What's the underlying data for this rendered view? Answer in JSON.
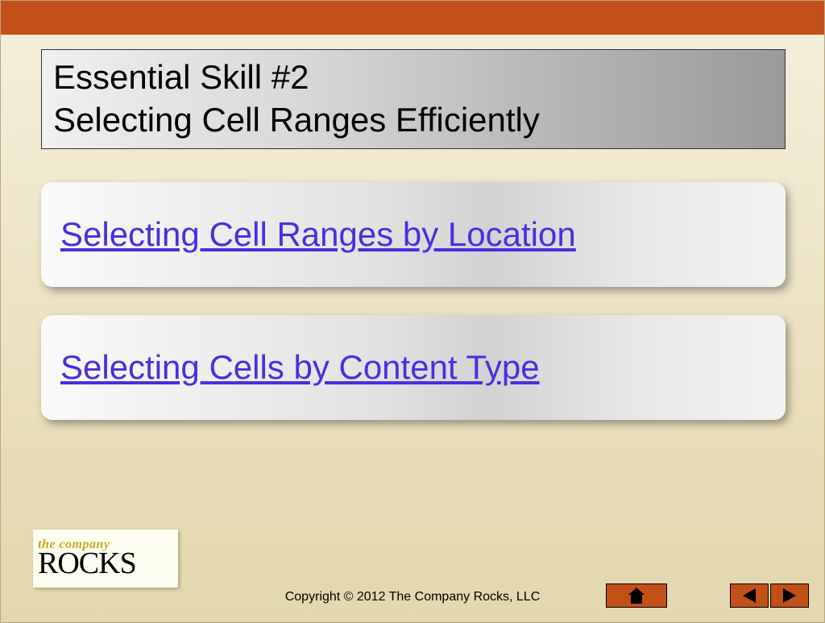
{
  "title": {
    "line1": "Essential Skill #2",
    "line2": "Selecting Cell Ranges Efficiently"
  },
  "links": [
    {
      "label": "Selecting Cell Ranges by Location"
    },
    {
      "label": "Selecting Cells by Content Type"
    }
  ],
  "logo": {
    "top": "the company",
    "bottom": "ROCKS"
  },
  "copyright": "Copyright © 2012 The Company Rocks, LLC",
  "nav": {
    "home": "home-icon",
    "prev": "arrow-left-icon",
    "next": "arrow-right-icon"
  }
}
